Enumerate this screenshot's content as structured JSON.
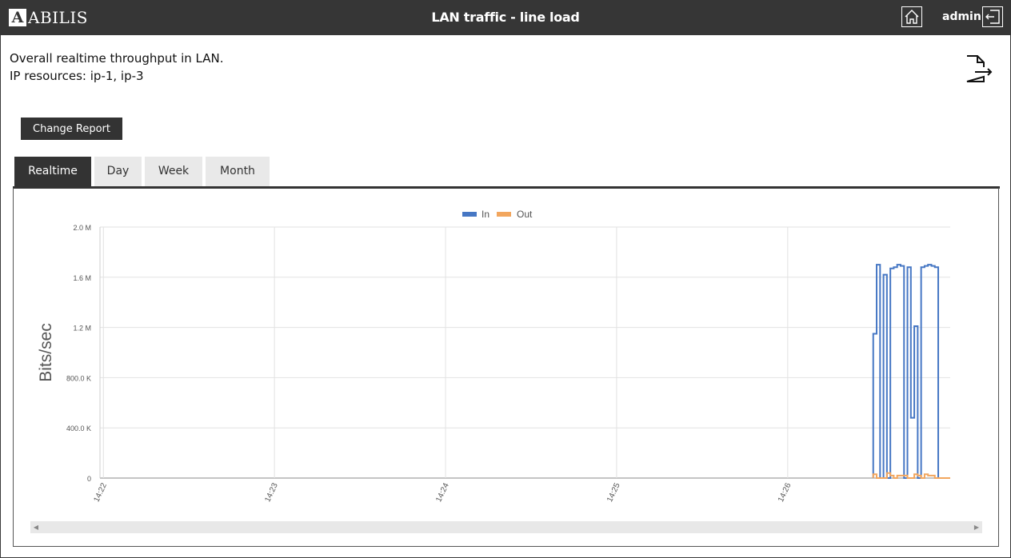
{
  "header": {
    "logo_text": "ABILIS",
    "logo_mark": "A",
    "title": "LAN traffic - line load",
    "user": "admin",
    "home_icon": "home-icon",
    "logout_icon": "logout-icon"
  },
  "description": {
    "line1": "Overall realtime throughput in LAN.",
    "line2": "IP resources: ip-1, ip-3"
  },
  "actions": {
    "export_icon": "export-document-icon",
    "change_report_label": "Change Report"
  },
  "tabs": [
    {
      "label": "Realtime",
      "active": true
    },
    {
      "label": "Day",
      "active": false
    },
    {
      "label": "Week",
      "active": false
    },
    {
      "label": "Month",
      "active": false
    }
  ],
  "chart_data": {
    "type": "line",
    "step": true,
    "title": "",
    "ylabel": "Bits/sec",
    "xlabel": "",
    "ylim": [
      0,
      2000000
    ],
    "y_ticks": [
      "0",
      "400.0 K",
      "800.0 K",
      "1.2 M",
      "1.6 M",
      "2.0 M"
    ],
    "x_ticks": [
      "14:22",
      "14:23",
      "14:24",
      "14:25",
      "14:26"
    ],
    "x_range_minutes": [
      -0.02,
      4.95
    ],
    "grid": true,
    "legend_position": "top-center",
    "colors": {
      "In": "#4677c4",
      "Out": "#f2a65e"
    },
    "series": [
      {
        "name": "In",
        "x": [
          4.5,
          4.52,
          4.54,
          4.56,
          4.58,
          4.6,
          4.62,
          4.64,
          4.66,
          4.68,
          4.7,
          4.72,
          4.74,
          4.76,
          4.78,
          4.8,
          4.82,
          4.84,
          4.86,
          4.88,
          4.9,
          4.92,
          4.94
        ],
        "y": [
          1150000,
          1700000,
          0,
          1620000,
          0,
          1670000,
          1680000,
          1700000,
          1690000,
          0,
          1680000,
          480000,
          1210000,
          0,
          1680000,
          1690000,
          1700000,
          1690000,
          1680000,
          0,
          0,
          0,
          0
        ]
      },
      {
        "name": "Out",
        "x": [
          4.5,
          4.52,
          4.54,
          4.56,
          4.58,
          4.6,
          4.62,
          4.64,
          4.66,
          4.68,
          4.7,
          4.72,
          4.74,
          4.76,
          4.78,
          4.8,
          4.82,
          4.84,
          4.86,
          4.88,
          4.9,
          4.92,
          4.94
        ],
        "y": [
          30000,
          0,
          0,
          0,
          40000,
          20000,
          0,
          20000,
          20000,
          20000,
          0,
          0,
          30000,
          20000,
          0,
          30000,
          20000,
          20000,
          0,
          0,
          0,
          0,
          0
        ]
      }
    ]
  }
}
